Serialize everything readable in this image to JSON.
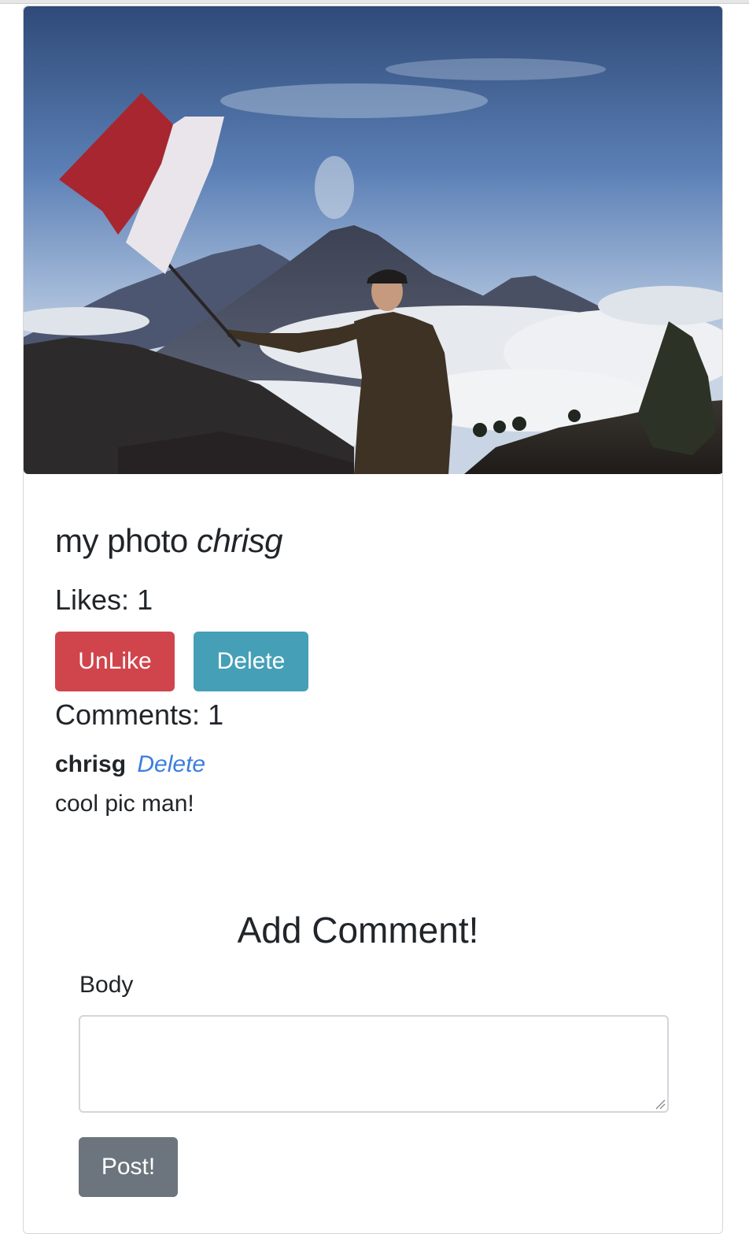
{
  "post": {
    "caption": "my photo",
    "author": "chrisg",
    "image_alt": "Person waving a red and white flag in front of a volcano above the clouds"
  },
  "likes": {
    "label": "Likes:",
    "count": "1"
  },
  "actions": {
    "unlike_label": "UnLike",
    "delete_label": "Delete"
  },
  "comments": {
    "label": "Comments:",
    "count": "1",
    "items": [
      {
        "author": "chrisg",
        "delete_label": "Delete",
        "body": "cool pic man!"
      }
    ]
  },
  "add_comment": {
    "title": "Add Comment!",
    "body_label": "Body",
    "body_value": "",
    "submit_label": "Post!"
  },
  "colors": {
    "unlike_button": "#d0454c",
    "delete_button": "#45a0b7",
    "post_button": "#6c757d",
    "link": "#3b7ddd"
  }
}
